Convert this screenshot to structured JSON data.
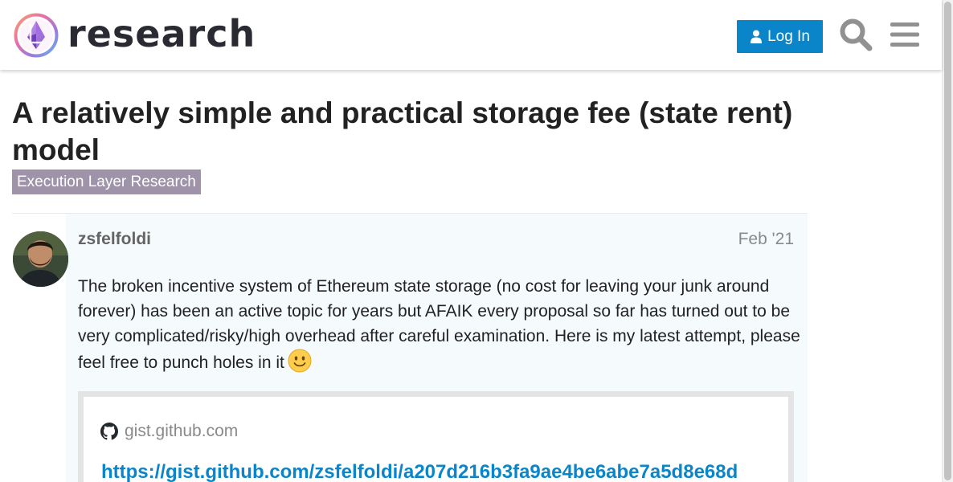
{
  "header": {
    "brand": "research",
    "login_label": "Log In",
    "search_icon": "search-icon",
    "menu_icon": "hamburger-menu-icon"
  },
  "topic": {
    "title": "A relatively simple and practical storage fee (state rent) model",
    "category": "Execution Layer Research",
    "category_color": "#9e93a8"
  },
  "post": {
    "username": "zsfelfoldi",
    "date": "Feb '21",
    "body": "The broken incentive system of Ethereum state storage (no cost for leaving your junk around forever) has been an active topic for years but AFAIK every proposal so far has turned out to be very complicated/risky/high overhead after careful examination. Here is my latest attempt, please feel free to punch holes in it",
    "emoji": "slightly-smiling-face-icon"
  },
  "onebox": {
    "source": "gist.github.com",
    "link": "https://gist.github.com/zsfelfoldi/a207d216b3fa9ae4be6abe7a5d8e68d"
  },
  "colors": {
    "accent": "#0a85c9",
    "text": "#222222",
    "muted": "#8a8a8a"
  }
}
